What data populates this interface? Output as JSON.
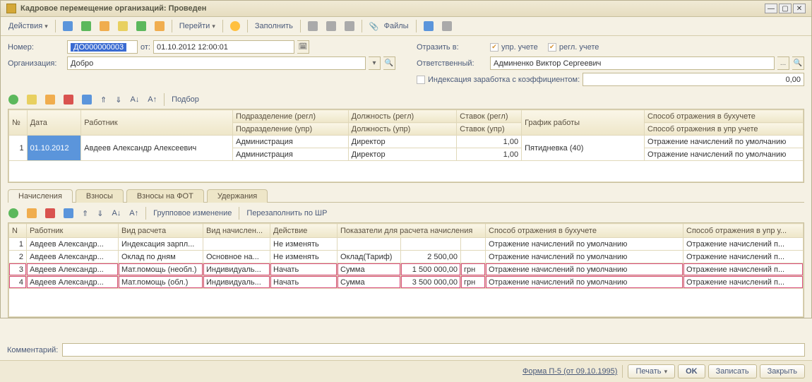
{
  "title": "Кадровое перемещение организаций: Проведен",
  "toolbar": {
    "actions": "Действия",
    "go": "Перейти",
    "fill": "Заполнить",
    "files": "Файлы"
  },
  "form": {
    "number_label": "Номер:",
    "number_value": "ДО000000003",
    "ot": "от:",
    "date": "01.10.2012 12:00:01",
    "org_label": "Организация:",
    "org_value": "Добро",
    "reflect_label": "Отразить в:",
    "upr": "упр. учете",
    "regl": "регл. учете",
    "resp_label": "Ответственный:",
    "resp_value": "Админенко Виктор Сергеевич",
    "index_label": "Индексация заработка с коэффициентом:",
    "index_value": "0,00"
  },
  "gridtoolbar": {
    "podbor": "Подбор"
  },
  "grid1": {
    "headers": {
      "n": "№",
      "date": "Дата",
      "worker": "Работник",
      "podr_regl": "Подразделение (регл)",
      "dolzh_regl": "Должность (регл)",
      "stavok_regl": "Ставок (регл)",
      "grafik": "График работы",
      "buh": "Способ отражения в бухучете",
      "podr_upr": "Подразделение (упр)",
      "dolzh_upr": "Должность (упр)",
      "stavok_upr": "Ставок (упр)",
      "upr_way": "Способ отражения в упр учете"
    },
    "row": {
      "n": "1",
      "date": "01.10.2012",
      "worker": "Авдеев Александр Алексеевич",
      "podr1": "Администрация",
      "dolzh1": "Директор",
      "stavok1": "1,00",
      "grafik": "Пятидневка (40)",
      "buh": "Отражение начислений по умолчанию",
      "podr2": "Администрация",
      "dolzh2": "Директор",
      "stavok2": "1,00",
      "upr": "Отражение начислений по умолчанию"
    }
  },
  "tabs": {
    "t1": "Начисления",
    "t2": "Взносы",
    "t3": "Взносы на ФОТ",
    "t4": "Удержания"
  },
  "gridtoolbar2": {
    "group": "Групповое изменение",
    "refill": "Перезаполнить по ШР"
  },
  "grid2": {
    "headers": {
      "n": "N",
      "worker": "Работник",
      "vid_rasch": "Вид расчета",
      "vid_nach": "Вид начислен...",
      "action": "Действие",
      "pokaz": "Показатели для расчета начисления",
      "buh": "Способ отражения в бухучете",
      "upr": "Способ отражения в упр у..."
    },
    "rows": [
      {
        "n": "1",
        "worker": "Авдеев Александр...",
        "vr": "Индексация зарпл...",
        "vn": "",
        "act": "Не изменять",
        "pk": "",
        "pv": "",
        "cur": "",
        "buh": "Отражение начислений по умолчанию",
        "upr": "Отражение начислений п..."
      },
      {
        "n": "2",
        "worker": "Авдеев Александр...",
        "vr": "Оклад по дням",
        "vn": "Основное на...",
        "act": "Не изменять",
        "pk": "Оклад(Тариф)",
        "pv": "2 500,00",
        "cur": "",
        "buh": "Отражение начислений по умолчанию",
        "upr": "Отражение начислений п..."
      },
      {
        "n": "3",
        "worker": "Авдеев Александр...",
        "vr": "Мат.помощь (необл.)",
        "vn": "Индивидуаль...",
        "act": "Начать",
        "pk": "Сумма",
        "pv": "1 500 000,00",
        "cur": "грн",
        "buh": "Отражение начислений по умолчанию",
        "upr": "Отражение начислений п..."
      },
      {
        "n": "4",
        "worker": "Авдеев Александр...",
        "vr": "Мат.помощь (обл.)",
        "vn": "Индивидуаль...",
        "act": "Начать",
        "pk": "Сумма",
        "pv": "3 500 000,00",
        "cur": "грн",
        "buh": "Отражение начислений по умолчанию",
        "upr": "Отражение начислений п..."
      }
    ]
  },
  "comment_label": "Комментарий:",
  "bottom": {
    "form": "Форма П-5 (от 09.10.1995)",
    "print": "Печать",
    "ok": "OK",
    "save": "Записать",
    "close": "Закрыть"
  }
}
